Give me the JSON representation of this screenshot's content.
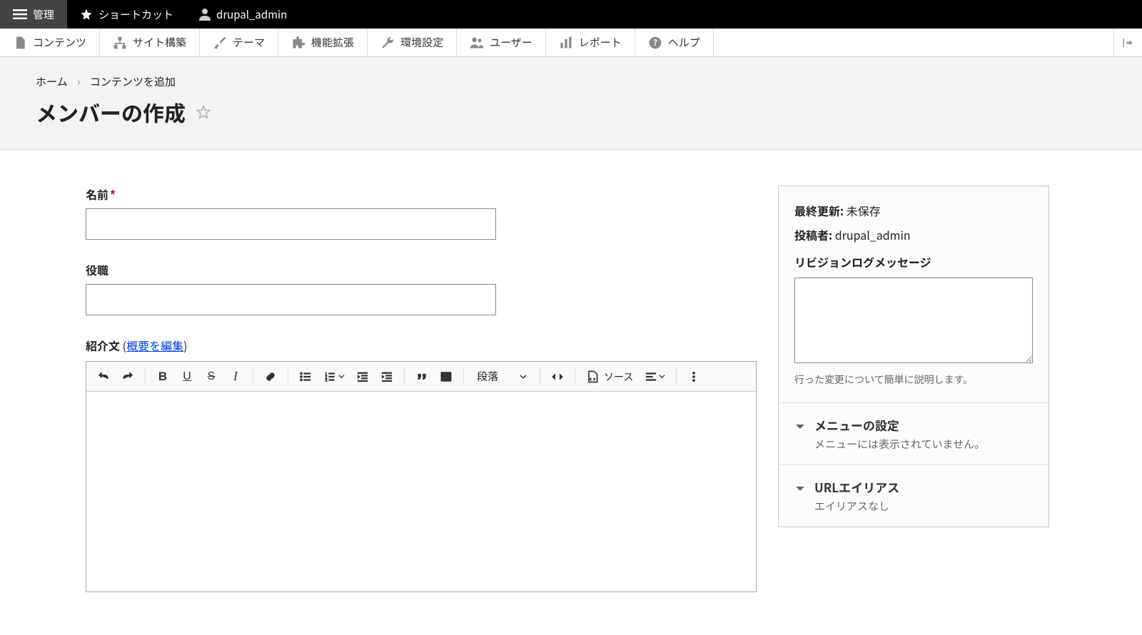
{
  "topbar": {
    "manage": "管理",
    "shortcut": "ショートカット",
    "user": "drupal_admin"
  },
  "adminmenu": {
    "content": "コンテンツ",
    "structure": "サイト構築",
    "appearance": "テーマ",
    "extend": "機能拡張",
    "config": "環境設定",
    "people": "ユーザー",
    "reports": "レポート",
    "help": "ヘルプ"
  },
  "breadcrumb": {
    "home": "ホーム",
    "add": "コンテンツを追加"
  },
  "page_title": "メンバーの作成",
  "form": {
    "name_label": "名前",
    "position_label": "役職",
    "intro_label": "紹介文",
    "edit_summary_text": "概要を編集",
    "paragraph_select": "段落",
    "source_label": "ソース"
  },
  "sidebar": {
    "last_updated_label": "最終更新:",
    "last_updated_value": "未保存",
    "author_label": "投稿者:",
    "author_value": "drupal_admin",
    "revision_label": "リビジョンログメッセージ",
    "revision_desc": "行った変更について簡単に説明します。",
    "acc": {
      "menu_title": "メニューの設定",
      "menu_sub": "メニューには表示されていません。",
      "alias_title": "URLエイリアス",
      "alias_sub": "エイリアスなし"
    }
  }
}
